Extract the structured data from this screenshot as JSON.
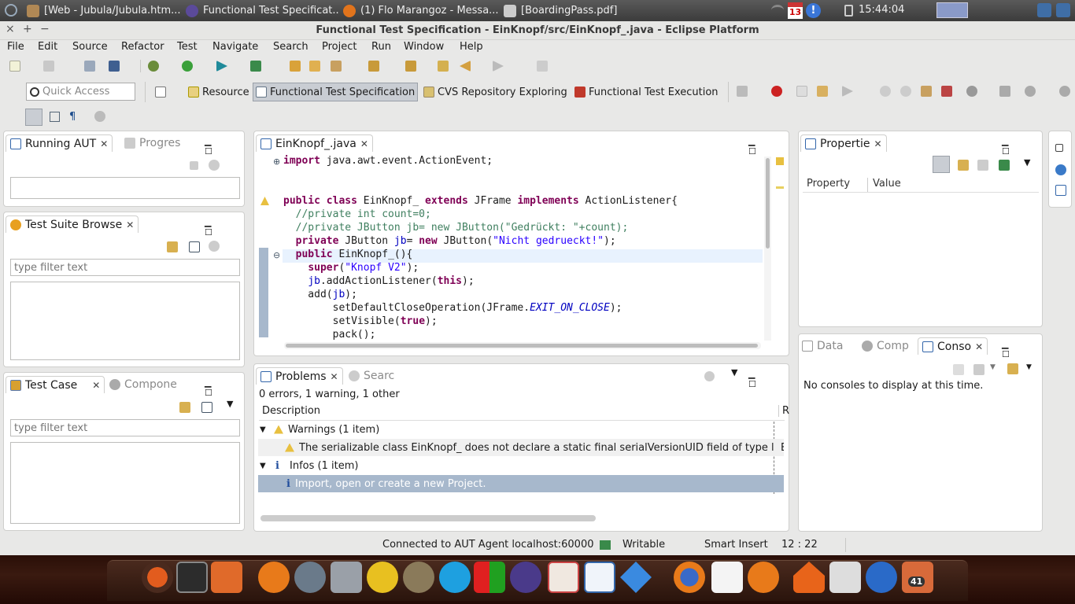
{
  "topbar": {
    "tasks": [
      {
        "label": "[Web - Jubula/Jubula.htm..."
      },
      {
        "label": "Functional Test Specificat..."
      },
      {
        "label": "(1) Flo Marangoz - Messa..."
      },
      {
        "label": "[BoardingPass.pdf]"
      }
    ],
    "calendar_day": "13",
    "clock": "15:44:04"
  },
  "window": {
    "title": "Functional Test Specification - EinKnopf/src/EinKnopf_.java - Eclipse Platform",
    "controls": [
      "×",
      "+",
      "−"
    ]
  },
  "menu": [
    "File",
    "Edit",
    "Source",
    "Refactor",
    "Test",
    "Navigate",
    "Search",
    "Project",
    "Run",
    "Window",
    "Help"
  ],
  "quick_access": {
    "placeholder": "Quick Access"
  },
  "perspectives": [
    {
      "label": "Resource"
    },
    {
      "label": "Functional Test Specification"
    },
    {
      "label": "CVS Repository Exploring"
    },
    {
      "label": "Functional Test Execution"
    }
  ],
  "left": {
    "running": {
      "tab": "Running AUT",
      "tab2": "Progres"
    },
    "suite": {
      "tab": "Test Suite Browse",
      "filter_placeholder": "type filter text"
    },
    "testcase": {
      "tab": "Test Case",
      "tab2": "Compone",
      "filter_placeholder": "type filter text"
    }
  },
  "editor": {
    "tab": "EinKnopf_.java",
    "lines": [
      {
        "segs": [
          {
            "c": "kw",
            "t": "import"
          },
          {
            "c": "",
            "t": " java.awt.event.ActionEvent;"
          }
        ]
      },
      {
        "segs": [
          {
            "c": "",
            "t": ""
          }
        ]
      },
      {
        "segs": [
          {
            "c": "",
            "t": ""
          }
        ]
      },
      {
        "segs": [
          {
            "c": "kw",
            "t": "public class"
          },
          {
            "c": "",
            "t": " EinKnopf_ "
          },
          {
            "c": "kw",
            "t": "extends"
          },
          {
            "c": "",
            "t": " JFrame "
          },
          {
            "c": "kw",
            "t": "implements"
          },
          {
            "c": "",
            "t": " ActionListener{"
          }
        ]
      },
      {
        "segs": [
          {
            "c": "cm",
            "t": "  //private int count=0;"
          }
        ]
      },
      {
        "segs": [
          {
            "c": "cm",
            "t": "  //private JButton jb= new JButton(\"Gedrückt: \"+count);"
          }
        ]
      },
      {
        "segs": [
          {
            "c": "",
            "t": "  "
          },
          {
            "c": "kw",
            "t": "private"
          },
          {
            "c": "",
            "t": " JButton "
          },
          {
            "c": "fld",
            "t": "jb"
          },
          {
            "c": "",
            "t": "= "
          },
          {
            "c": "kw",
            "t": "new"
          },
          {
            "c": "",
            "t": " JButton("
          },
          {
            "c": "str",
            "t": "\"Nicht gedrueckt!\""
          },
          {
            "c": "",
            "t": ");"
          }
        ]
      },
      {
        "segs": [
          {
            "c": "",
            "t": "  "
          },
          {
            "c": "kw",
            "t": "public"
          },
          {
            "c": "",
            "t": " EinKnopf_(){"
          }
        ]
      },
      {
        "segs": [
          {
            "c": "",
            "t": "    "
          },
          {
            "c": "kw",
            "t": "super"
          },
          {
            "c": "",
            "t": "("
          },
          {
            "c": "str",
            "t": "\"Knopf V2\""
          },
          {
            "c": "",
            "t": ");"
          }
        ]
      },
      {
        "segs": [
          {
            "c": "",
            "t": "    "
          },
          {
            "c": "fld",
            "t": "jb"
          },
          {
            "c": "",
            "t": ".addActionListener("
          },
          {
            "c": "kw",
            "t": "this"
          },
          {
            "c": "",
            "t": ");"
          }
        ]
      },
      {
        "segs": [
          {
            "c": "",
            "t": "    add("
          },
          {
            "c": "fld",
            "t": "jb"
          },
          {
            "c": "",
            "t": ");"
          }
        ]
      },
      {
        "segs": [
          {
            "c": "",
            "t": "        setDefaultCloseOperation(JFrame."
          },
          {
            "c": "it",
            "t": "EXIT_ON_CLOSE"
          },
          {
            "c": "",
            "t": ");"
          }
        ]
      },
      {
        "segs": [
          {
            "c": "",
            "t": "        setVisible("
          },
          {
            "c": "kw",
            "t": "true"
          },
          {
            "c": "",
            "t": ");"
          }
        ]
      },
      {
        "segs": [
          {
            "c": "",
            "t": "        pack();"
          }
        ]
      }
    ]
  },
  "problems": {
    "tab": "Problems",
    "tab2": "Searc",
    "summary": "0 errors, 1 warning, 1 other",
    "col_description": "Description",
    "col_r": "R",
    "warnings_group": "Warnings (1 item)",
    "warning_item": "The serializable class EinKnopf_ does not declare a static final serialVersionUID field of type l",
    "warning_trail": "E",
    "infos_group": "Infos (1 item)",
    "info_item": "Import, open or create a new Project."
  },
  "properties": {
    "tab": "Propertie",
    "col_property": "Property",
    "col_value": "Value"
  },
  "console": {
    "tab_data": "Data",
    "tab_comp": "Comp",
    "tab": "Conso",
    "message": "No consoles to display at this time."
  },
  "status": {
    "connection": "Connected to AUT Agent localhost:60000",
    "writable": "Writable",
    "insert": "Smart Insert",
    "position": "12 : 22"
  },
  "dock": {
    "badge": "41"
  },
  "colors": {
    "selection": "#a7b8cc",
    "keyword": "#7f0055",
    "string": "#2a00ff",
    "comment": "#3f7f5f"
  }
}
